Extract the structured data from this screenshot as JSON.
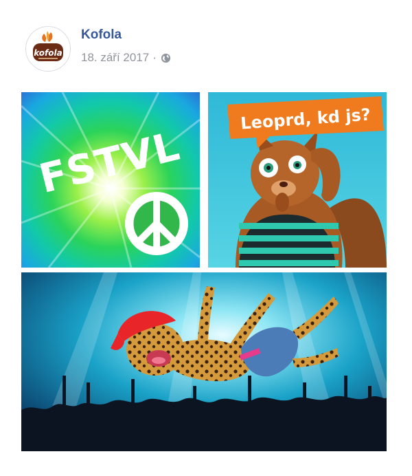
{
  "post": {
    "author": "Kofola",
    "date": "18. září 2017",
    "separator": "·",
    "privacy_icon": "globe-icon"
  },
  "avatar": {
    "logo_text": "kofola",
    "colors": {
      "brown": "#6b2a14",
      "orange": "#e8731e"
    }
  },
  "photos": {
    "fstvl": {
      "title": "FSTVL",
      "icon": "peace-sign-icon"
    },
    "squirrel": {
      "speech": "Leoprd, kd js?"
    },
    "concert": {
      "subject": "leopard-icon"
    }
  },
  "colors": {
    "link": "#365899",
    "meta": "#90949c",
    "speech_bubble": "#f07a1e"
  }
}
